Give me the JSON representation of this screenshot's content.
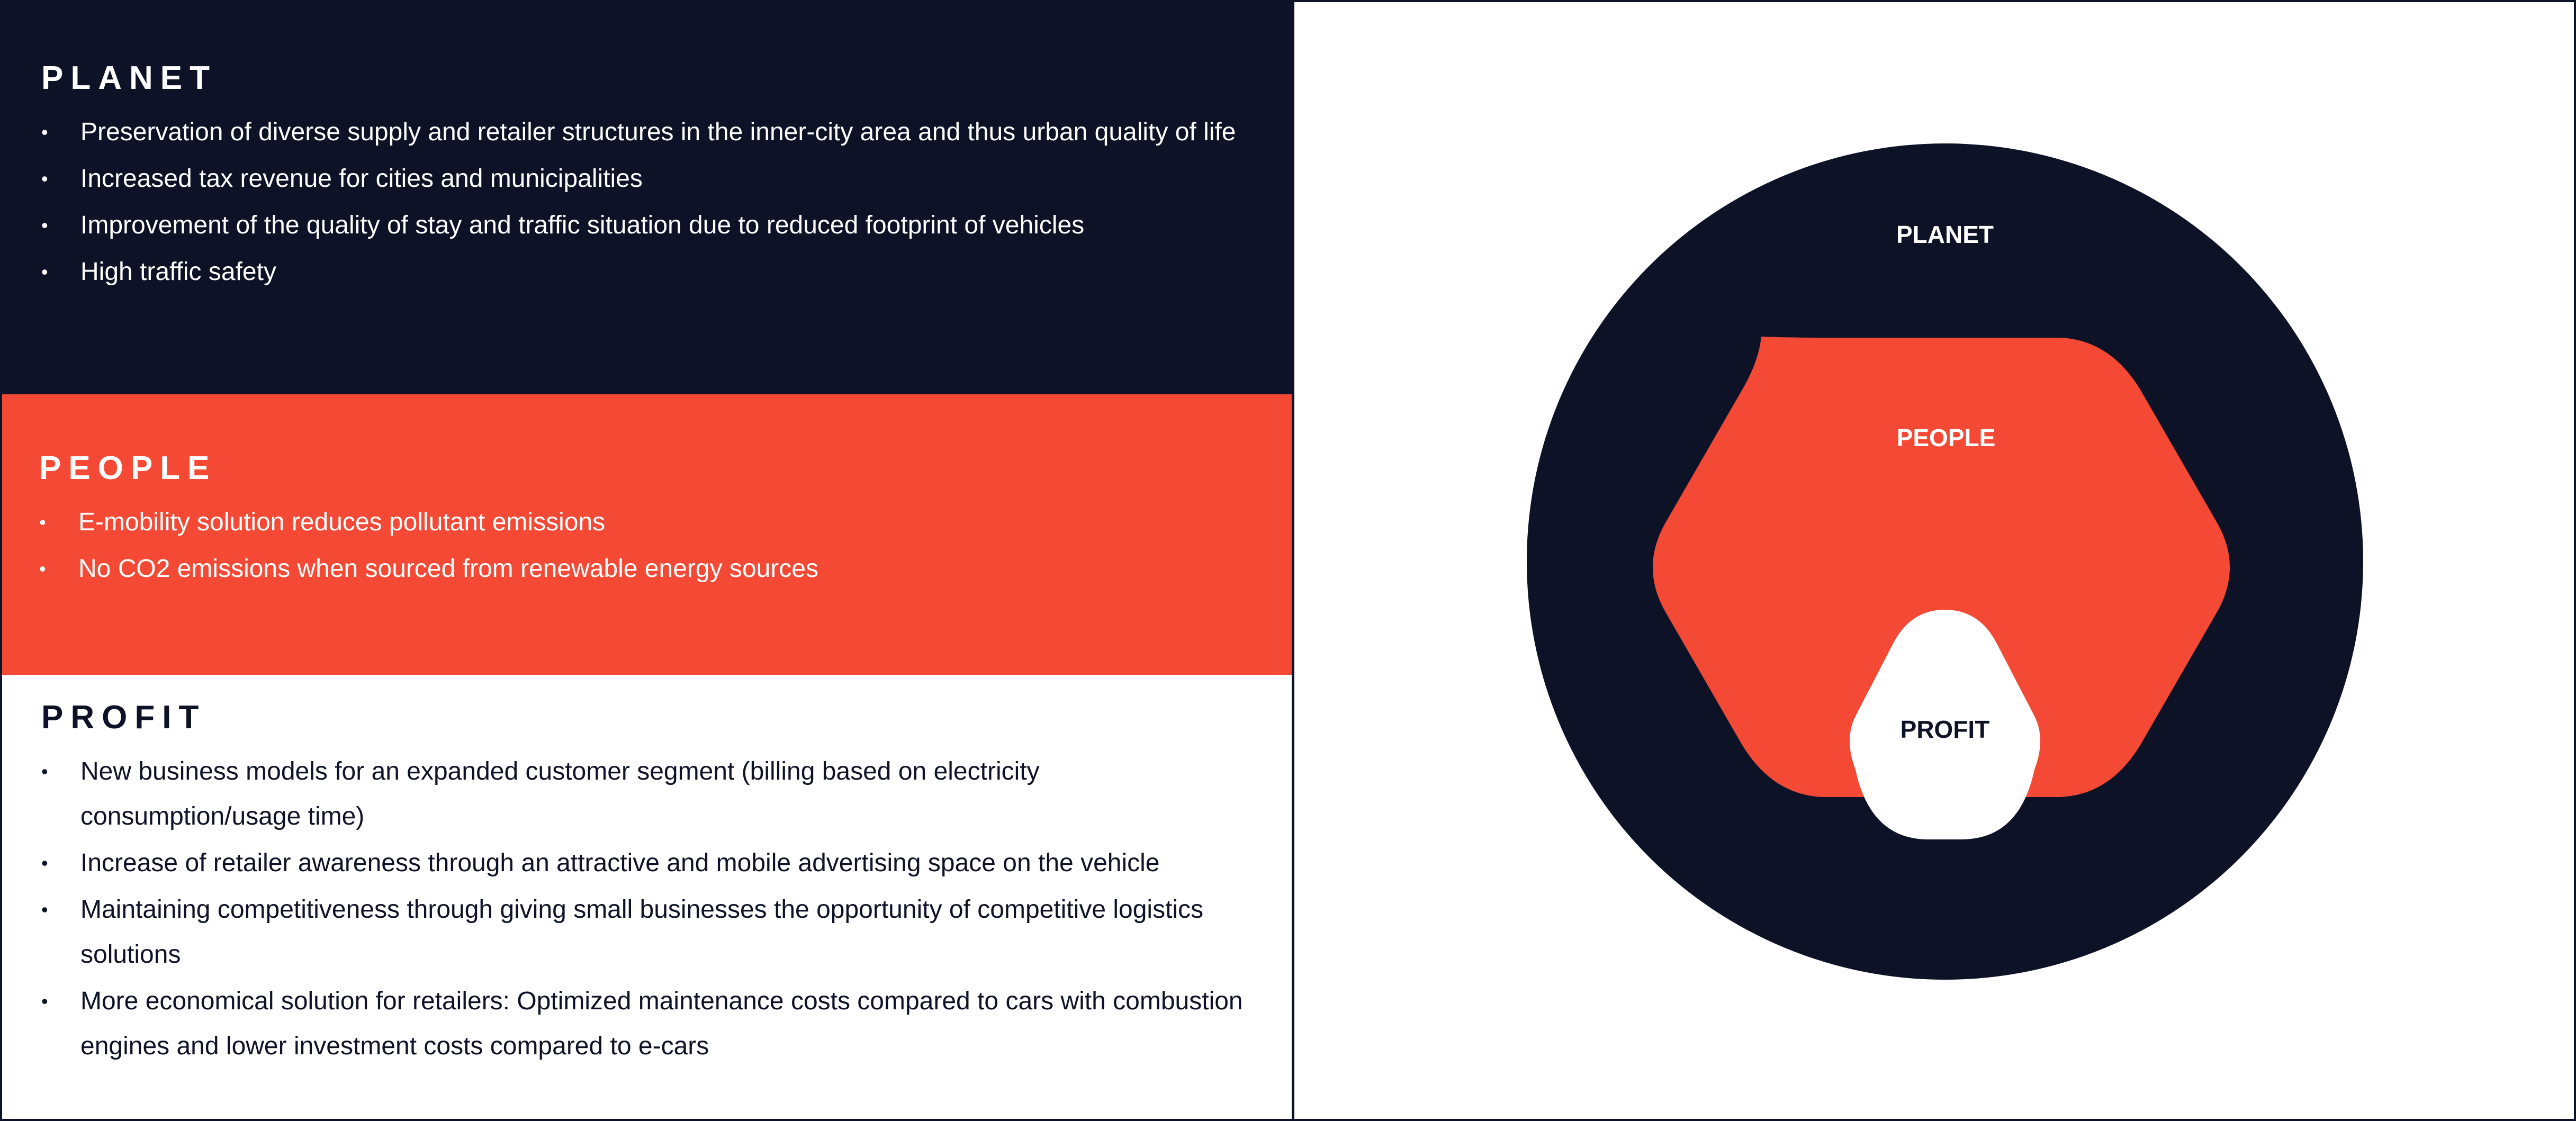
{
  "colors": {
    "navy": "#0d1226",
    "coral": "#f44a35",
    "white": "#ffffff"
  },
  "sections": {
    "planet": {
      "heading": "PLANET",
      "bullets": [
        "Preservation of diverse supply and retailer structures in the inner-city area and thus urban quality of life",
        "Increased tax revenue for cities and municipalities",
        "Improvement of the quality of stay and traffic situation due to reduced footprint of vehicles",
        "High traffic safety"
      ]
    },
    "people": {
      "heading": "PEOPLE",
      "bullets": [
        "E-mobility solution reduces pollutant emissions",
        "No CO2 emissions when sourced from renewable energy sources"
      ]
    },
    "profit": {
      "heading": "PROFIT",
      "bullets": [
        "New business models for an expanded customer segment (billing based on electricity consumption/usage time)",
        "Increase of retailer awareness through an attractive and mobile advertising space on the vehicle",
        "Maintaining competitiveness through giving small businesses the opportunity of competitive logistics solutions",
        "More economical solution for retailers: Optimized maintenance costs compared to cars with combustion engines and lower investment costs compared to e-cars"
      ]
    }
  },
  "diagram": {
    "outer_label": "PLANET",
    "middle_label": "PEOPLE",
    "inner_label": "PROFIT"
  }
}
